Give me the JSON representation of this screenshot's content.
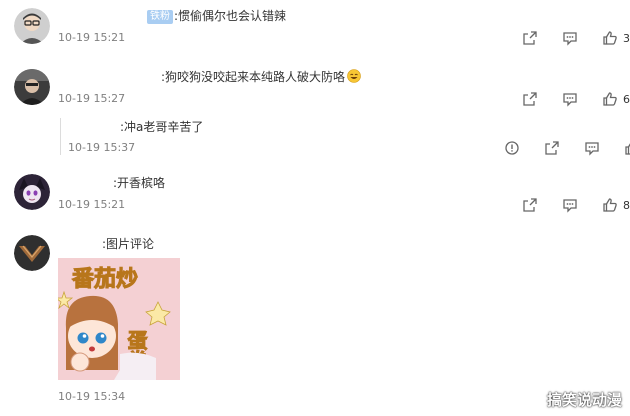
{
  "comments": [
    {
      "badge": "铁粉",
      "text": ":惯偷偶尔也会认错辣",
      "time": "10-19 15:21",
      "likes": "3"
    },
    {
      "text": ":狗咬狗没咬起来本纯路人破大防咯",
      "emoji": "smiling-face-emoji",
      "time": "10-19 15:27",
      "likes": "6"
    },
    {
      "text": ":冲a老哥辛苦了",
      "time": "10-19 15:37"
    },
    {
      "text": ":开香槟咯",
      "time": "10-19 15:21",
      "likes": "8"
    },
    {
      "text": ":图片评论",
      "time": "10-19 15:34",
      "sticker_text": [
        "番茄炒",
        "蛋拳"
      ]
    }
  ],
  "icons": {
    "share": "share-icon",
    "comment": "comment-icon",
    "like": "thumbs-up-icon",
    "report": "report-icon"
  },
  "watermark": "搞笑说动漫",
  "colors": {
    "badge_bg": "#a9cdf2",
    "time_text": "#808080",
    "icon_gray": "#666666"
  }
}
